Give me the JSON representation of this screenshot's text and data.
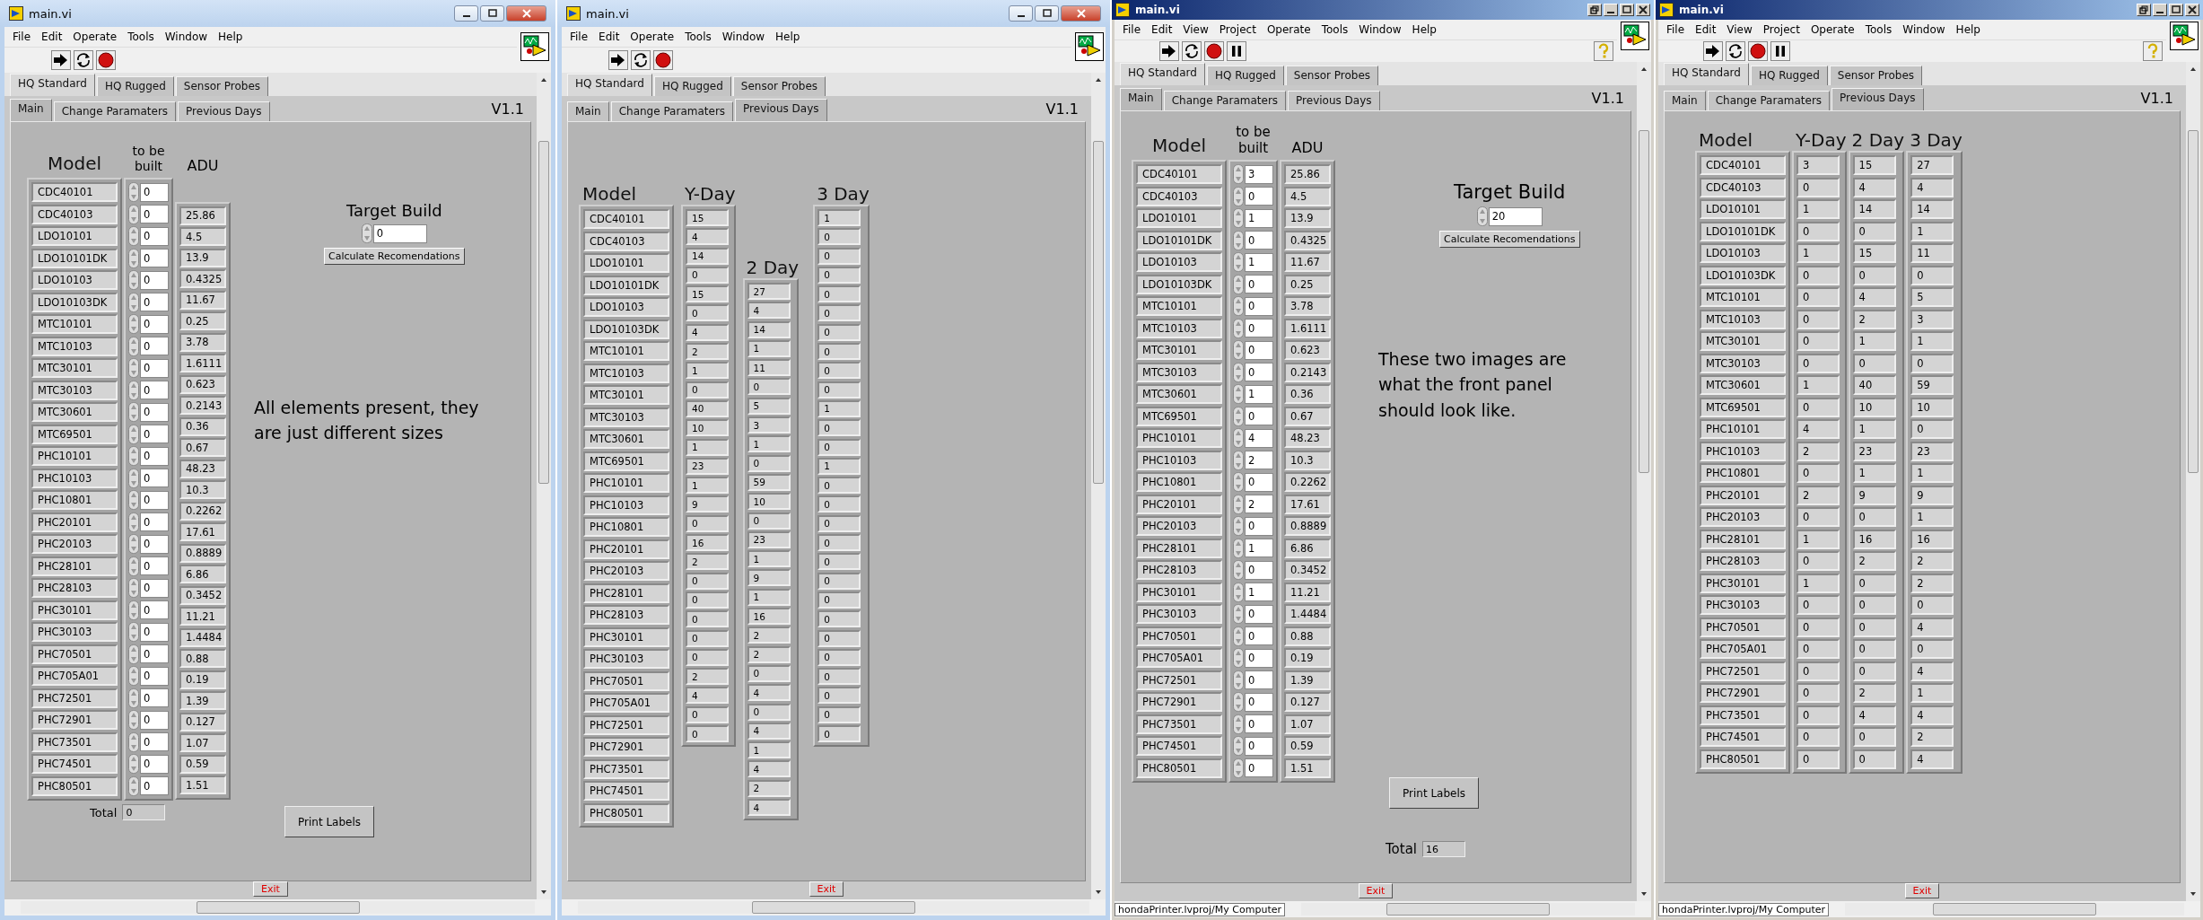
{
  "windows": [
    {
      "kind": "modern",
      "title": "main.vi",
      "menu": [
        "File",
        "Edit",
        "Operate",
        "Tools",
        "Window",
        "Help"
      ],
      "toolbar": [
        {
          "kind": "run"
        },
        {
          "kind": "run-continuously"
        },
        {
          "kind": "abort"
        }
      ],
      "tabs": [
        {
          "label": "HQ Standard",
          "selected": true
        },
        {
          "label": "HQ Rugged",
          "selected": false
        },
        {
          "label": "Sensor Probes",
          "selected": false
        }
      ],
      "subtabs": [
        {
          "label": "Main",
          "selected": true
        },
        {
          "label": "Change Paramaters",
          "selected": false
        },
        {
          "label": "Previous Days",
          "selected": false
        }
      ],
      "version": "V1.1",
      "panel": {
        "kind": "main",
        "headers": {
          "model": "Model",
          "to_be_built": "to be built",
          "adu": "ADU"
        },
        "rows": [
          {
            "model": "CDC40101",
            "to_be_built": "0"
          },
          {
            "model": "CDC40103",
            "to_be_built": "0"
          },
          {
            "model": "LDO10101",
            "to_be_built": "0"
          },
          {
            "model": "LDO10101DK",
            "to_be_built": "0"
          },
          {
            "model": "LDO10103",
            "to_be_built": "0"
          },
          {
            "model": "LDO10103DK",
            "to_be_built": "0"
          },
          {
            "model": "MTC10101",
            "to_be_built": "0"
          },
          {
            "model": "MTC10103",
            "to_be_built": "0"
          },
          {
            "model": "MTC30101",
            "to_be_built": "0"
          },
          {
            "model": "MTC30103",
            "to_be_built": "0"
          },
          {
            "model": "MTC30601",
            "to_be_built": "0"
          },
          {
            "model": "MTC69501",
            "to_be_built": "0"
          },
          {
            "model": "PHC10101",
            "to_be_built": "0"
          },
          {
            "model": "PHC10103",
            "to_be_built": "0"
          },
          {
            "model": "PHC10801",
            "to_be_built": "0"
          },
          {
            "model": "PHC20101",
            "to_be_built": "0"
          },
          {
            "model": "PHC20103",
            "to_be_built": "0"
          },
          {
            "model": "PHC28101",
            "to_be_built": "0"
          },
          {
            "model": "PHC28103",
            "to_be_built": "0"
          },
          {
            "model": "PHC30101",
            "to_be_built": "0"
          },
          {
            "model": "PHC30103",
            "to_be_built": "0"
          },
          {
            "model": "PHC70501",
            "to_be_built": "0"
          },
          {
            "model": "PHC705A01",
            "to_be_built": "0"
          },
          {
            "model": "PHC72501",
            "to_be_built": "0"
          },
          {
            "model": "PHC72901",
            "to_be_built": "0"
          },
          {
            "model": "PHC73501",
            "to_be_built": "0"
          },
          {
            "model": "PHC74501",
            "to_be_built": "0"
          },
          {
            "model": "PHC80501",
            "to_be_built": "0"
          }
        ],
        "adu": [
          "25.86",
          "4.5",
          "13.9",
          "0.4325",
          "11.67",
          "0.25",
          "3.78",
          "1.6111",
          "0.623",
          "0.2143",
          "0.36",
          "0.67",
          "48.23",
          "10.3",
          "0.2262",
          "17.61",
          "0.8889",
          "6.86",
          "0.3452",
          "11.21",
          "1.4484",
          "0.88",
          "0.19",
          "1.39",
          "0.127",
          "1.07",
          "0.59",
          "1.51"
        ],
        "target_build": {
          "label": "Target Build",
          "value": "0"
        },
        "calculate_button": "Calculate Recomendations",
        "print_button": "Print Labels",
        "total": {
          "label": "Total",
          "value": "0"
        },
        "note": "All elements present, they are just different sizes"
      },
      "exit_button": "Exit"
    },
    {
      "kind": "modern",
      "title": "main.vi",
      "menu": [
        "File",
        "Edit",
        "Operate",
        "Tools",
        "Window",
        "Help"
      ],
      "toolbar": [
        {
          "kind": "run"
        },
        {
          "kind": "run-continuously"
        },
        {
          "kind": "abort"
        }
      ],
      "tabs": [
        {
          "label": "HQ Standard",
          "selected": true
        },
        {
          "label": "HQ Rugged",
          "selected": false
        },
        {
          "label": "Sensor Probes",
          "selected": false
        }
      ],
      "subtabs": [
        {
          "label": "Main",
          "selected": false
        },
        {
          "label": "Change Paramaters",
          "selected": false
        },
        {
          "label": "Previous Days",
          "selected": true
        }
      ],
      "version": "V1.1",
      "panel": {
        "kind": "previous_days",
        "columns": [
          {
            "label": "Model",
            "values": [
              "CDC40101",
              "CDC40103",
              "LDO10101",
              "LDO10101DK",
              "LDO10103",
              "LDO10103DK",
              "MTC10101",
              "MTC10103",
              "MTC30101",
              "MTC30103",
              "MTC30601",
              "MTC69501",
              "PHC10101",
              "PHC10103",
              "PHC10801",
              "PHC20101",
              "PHC20103",
              "PHC28101",
              "PHC28103",
              "PHC30101",
              "PHC30103",
              "PHC70501",
              "PHC705A01",
              "PHC72501",
              "PHC72901",
              "PHC73501",
              "PHC74501",
              "PHC80501"
            ]
          },
          {
            "label": "Y-Day",
            "values": [
              "15",
              "4",
              "14",
              "0",
              "15",
              "0",
              "4",
              "2",
              "1",
              "0",
              "40",
              "10",
              "1",
              "23",
              "1",
              "9",
              "0",
              "16",
              "2",
              "0",
              "0",
              "0",
              "0",
              "0",
              "2",
              "4",
              "0",
              "0"
            ]
          },
          {
            "label": "2 Day",
            "values": [
              "27",
              "4",
              "14",
              "1",
              "11",
              "0",
              "5",
              "3",
              "1",
              "0",
              "59",
              "10",
              "0",
              "23",
              "1",
              "9",
              "1",
              "16",
              "2",
              "2",
              "0",
              "4",
              "0",
              "4",
              "1",
              "4",
              "2",
              "4"
            ]
          },
          {
            "label": "3 Day",
            "values": [
              "1",
              "0",
              "0",
              "0",
              "0",
              "0",
              "0",
              "0",
              "0",
              "0",
              "1",
              "0",
              "0",
              "1",
              "0",
              "0",
              "0",
              "0",
              "0",
              "0",
              "0",
              "0",
              "0",
              "0",
              "0",
              "0",
              "0",
              "0"
            ]
          }
        ]
      },
      "exit_button": "Exit"
    },
    {
      "kind": "classic",
      "title": "main.vi",
      "menu": [
        "File",
        "Edit",
        "View",
        "Project",
        "Operate",
        "Tools",
        "Window",
        "Help"
      ],
      "toolbar": [
        {
          "kind": "run"
        },
        {
          "kind": "run-continuously"
        },
        {
          "kind": "abort"
        },
        {
          "kind": "pause"
        },
        {
          "kind": "help"
        }
      ],
      "tabs": [
        {
          "label": "HQ Standard",
          "selected": true
        },
        {
          "label": "HQ Rugged",
          "selected": false
        },
        {
          "label": "Sensor Probes",
          "selected": false
        }
      ],
      "subtabs": [
        {
          "label": "Main",
          "selected": true
        },
        {
          "label": "Change Paramaters",
          "selected": false
        },
        {
          "label": "Previous Days",
          "selected": false
        }
      ],
      "version": "V1.1",
      "panel": {
        "kind": "main",
        "headers": {
          "model": "Model",
          "to_be_built": "to be built",
          "adu": "ADU"
        },
        "rows": [
          {
            "model": "CDC40101",
            "to_be_built": "3"
          },
          {
            "model": "CDC40103",
            "to_be_built": "0"
          },
          {
            "model": "LDO10101",
            "to_be_built": "1"
          },
          {
            "model": "LDO10101DK",
            "to_be_built": "0"
          },
          {
            "model": "LDO10103",
            "to_be_built": "1"
          },
          {
            "model": "LDO10103DK",
            "to_be_built": "0"
          },
          {
            "model": "MTC10101",
            "to_be_built": "0"
          },
          {
            "model": "MTC10103",
            "to_be_built": "0"
          },
          {
            "model": "MTC30101",
            "to_be_built": "0"
          },
          {
            "model": "MTC30103",
            "to_be_built": "0"
          },
          {
            "model": "MTC30601",
            "to_be_built": "1"
          },
          {
            "model": "MTC69501",
            "to_be_built": "0"
          },
          {
            "model": "PHC10101",
            "to_be_built": "4"
          },
          {
            "model": "PHC10103",
            "to_be_built": "2"
          },
          {
            "model": "PHC10801",
            "to_be_built": "0"
          },
          {
            "model": "PHC20101",
            "to_be_built": "2"
          },
          {
            "model": "PHC20103",
            "to_be_built": "0"
          },
          {
            "model": "PHC28101",
            "to_be_built": "1"
          },
          {
            "model": "PHC28103",
            "to_be_built": "0"
          },
          {
            "model": "PHC30101",
            "to_be_built": "1"
          },
          {
            "model": "PHC30103",
            "to_be_built": "0"
          },
          {
            "model": "PHC70501",
            "to_be_built": "0"
          },
          {
            "model": "PHC705A01",
            "to_be_built": "0"
          },
          {
            "model": "PHC72501",
            "to_be_built": "0"
          },
          {
            "model": "PHC72901",
            "to_be_built": "0"
          },
          {
            "model": "PHC73501",
            "to_be_built": "0"
          },
          {
            "model": "PHC74501",
            "to_be_built": "0"
          },
          {
            "model": "PHC80501",
            "to_be_built": "0"
          }
        ],
        "adu": [
          "25.86",
          "4.5",
          "13.9",
          "0.4325",
          "11.67",
          "0.25",
          "3.78",
          "1.6111",
          "0.623",
          "0.2143",
          "0.36",
          "0.67",
          "48.23",
          "10.3",
          "0.2262",
          "17.61",
          "0.8889",
          "6.86",
          "0.3452",
          "11.21",
          "1.4484",
          "0.88",
          "0.19",
          "1.39",
          "0.127",
          "1.07",
          "0.59",
          "1.51"
        ],
        "target_build": {
          "label": "Target Build",
          "value": "20"
        },
        "calculate_button": "Calculate Recomendations",
        "print_button": "Print Labels",
        "total": {
          "label": "Total",
          "value": "16"
        },
        "note": "These two images are what the front panel should look like."
      },
      "exit_button": "Exit",
      "project_path": "hondaPrinter.lvproj/My Computer"
    },
    {
      "kind": "classic",
      "title": "main.vi",
      "menu": [
        "File",
        "Edit",
        "View",
        "Project",
        "Operate",
        "Tools",
        "Window",
        "Help"
      ],
      "toolbar": [
        {
          "kind": "run"
        },
        {
          "kind": "run-continuously"
        },
        {
          "kind": "abort"
        },
        {
          "kind": "pause"
        },
        {
          "kind": "help"
        }
      ],
      "tabs": [
        {
          "label": "HQ Standard",
          "selected": true
        },
        {
          "label": "HQ Rugged",
          "selected": false
        },
        {
          "label": "Sensor Probes",
          "selected": false
        }
      ],
      "subtabs": [
        {
          "label": "Main",
          "selected": false
        },
        {
          "label": "Change Paramaters",
          "selected": false
        },
        {
          "label": "Previous Days",
          "selected": true
        }
      ],
      "version": "V1.1",
      "panel": {
        "kind": "previous_days",
        "columns": [
          {
            "label": "Model",
            "values": [
              "CDC40101",
              "CDC40103",
              "LDO10101",
              "LDO10101DK",
              "LDO10103",
              "LDO10103DK",
              "MTC10101",
              "MTC10103",
              "MTC30101",
              "MTC30103",
              "MTC30601",
              "MTC69501",
              "PHC10101",
              "PHC10103",
              "PHC10801",
              "PHC20101",
              "PHC20103",
              "PHC28101",
              "PHC28103",
              "PHC30101",
              "PHC30103",
              "PHC70501",
              "PHC705A01",
              "PHC72501",
              "PHC72901",
              "PHC73501",
              "PHC74501",
              "PHC80501"
            ]
          },
          {
            "label": "Y-Day",
            "values": [
              "3",
              "0",
              "1",
              "0",
              "1",
              "0",
              "0",
              "0",
              "0",
              "0",
              "1",
              "0",
              "4",
              "2",
              "0",
              "2",
              "0",
              "1",
              "0",
              "1",
              "0",
              "0",
              "0",
              "0",
              "0",
              "0",
              "0",
              "0"
            ]
          },
          {
            "label": "2 Day",
            "values": [
              "15",
              "4",
              "14",
              "0",
              "15",
              "0",
              "4",
              "2",
              "1",
              "0",
              "40",
              "10",
              "1",
              "23",
              "1",
              "9",
              "0",
              "16",
              "2",
              "0",
              "0",
              "0",
              "0",
              "0",
              "2",
              "4",
              "0",
              "0"
            ]
          },
          {
            "label": "3 Day",
            "values": [
              "27",
              "4",
              "14",
              "1",
              "11",
              "0",
              "5",
              "3",
              "1",
              "0",
              "59",
              "10",
              "0",
              "23",
              "1",
              "9",
              "1",
              "16",
              "2",
              "2",
              "0",
              "4",
              "0",
              "4",
              "1",
              "4",
              "2",
              "4"
            ]
          }
        ]
      },
      "exit_button": "Exit",
      "project_path": "hondaPrinter.lvproj/My Computer"
    }
  ]
}
